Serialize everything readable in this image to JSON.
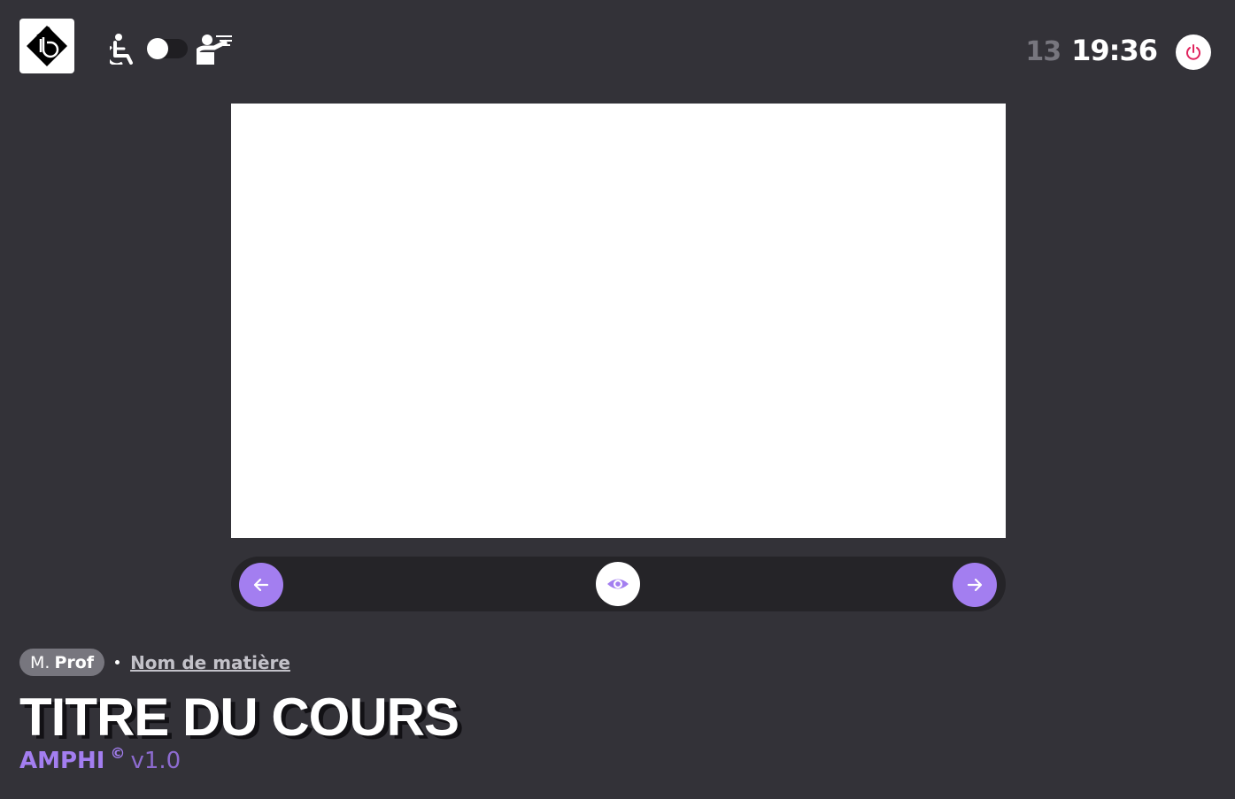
{
  "header": {
    "logo_icon": "app-logo-icon",
    "wheelchair_icon": "accessibility-icon",
    "teacher_icon": "presenter-icon",
    "toggle_state": "off",
    "clock": {
      "seconds": "13",
      "time": "19:36"
    },
    "power_icon": "power-icon"
  },
  "viewer": {
    "prev_icon": "arrow-left-icon",
    "view_icon": "eye-icon",
    "next_icon": "arrow-right-icon"
  },
  "course": {
    "teacher_prefix": "M.",
    "teacher_name": "Prof",
    "subject": "Nom de matière",
    "title": "TITRE DU COURS"
  },
  "brand": {
    "name": "AMPHI",
    "copyright": "©",
    "version": "v1.0"
  },
  "colors": {
    "background": "#333238",
    "accent": "#a37ef0",
    "power_accent": "#e0245e",
    "control_bar": "#252428"
  }
}
